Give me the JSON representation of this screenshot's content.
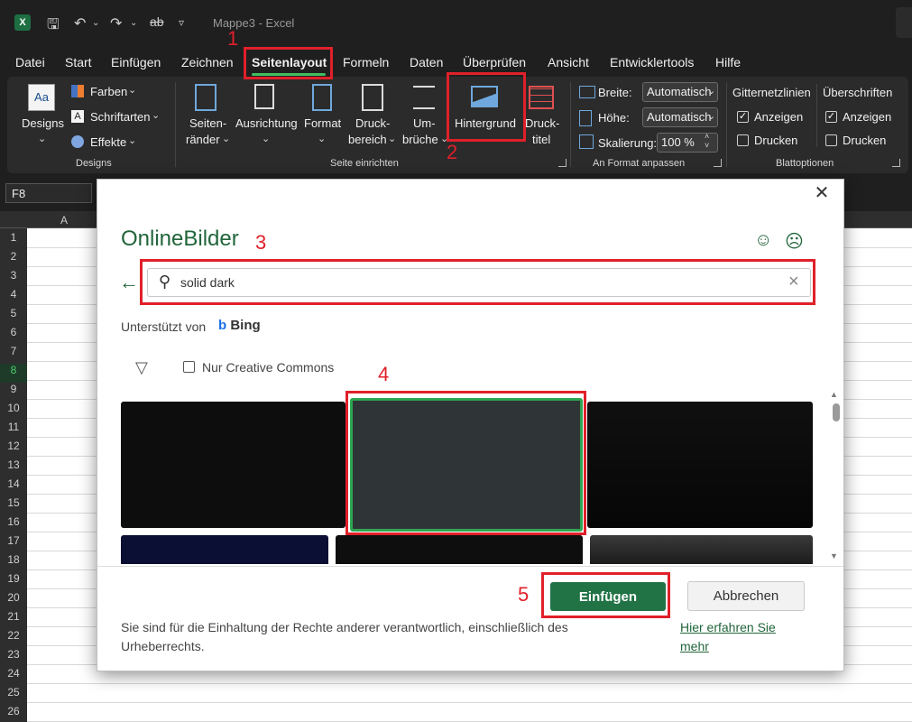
{
  "titlebar": {
    "document_title": "Mappe3  -  Excel"
  },
  "menu": {
    "tabs": [
      "Datei",
      "Start",
      "Einfügen",
      "Zeichnen",
      "Seitenlayout",
      "Formeln",
      "Daten",
      "Überprüfen",
      "Ansicht",
      "Entwicklertools",
      "Hilfe"
    ],
    "active": "Seitenlayout"
  },
  "ribbon": {
    "designs": {
      "designs_label": "Designs",
      "farben": "Farben",
      "schriftarten": "Schriftarten",
      "effekte": "Effekte",
      "group_label": "Designs"
    },
    "seite_einrichten": {
      "seitenraender_1": "Seiten-",
      "seitenraender_2": "ränder",
      "ausrichtung": "Ausrichtung",
      "format": "Format",
      "druckbereich_1": "Druck-",
      "druckbereich_2": "bereich",
      "umbrueche_1": "Um-",
      "umbrueche_2": "brüche",
      "hintergrund": "Hintergrund",
      "drucktitel_1": "Druck-",
      "drucktitel_2": "titel",
      "group_label": "Seite einrichten"
    },
    "an_format_anpassen": {
      "breite_label": "Breite:",
      "breite_value": "Automatisch",
      "hoehe_label": "Höhe:",
      "hoehe_value": "Automatisch",
      "skalierung_label": "Skalierung:",
      "skalierung_value": "100 %",
      "group_label": "An Format anpassen"
    },
    "blattoptionen": {
      "gitternetzlinien": "Gitternetzlinien",
      "ueberschriften": "Überschriften",
      "anzeigen": "Anzeigen",
      "drucken": "Drucken",
      "group_label": "Blattoptionen"
    }
  },
  "namebox": {
    "value": "F8"
  },
  "sheet": {
    "columns": [
      "A"
    ],
    "rows": [
      "1",
      "2",
      "3",
      "4",
      "5",
      "6",
      "7",
      "8",
      "9",
      "10",
      "11",
      "12",
      "13",
      "14",
      "15",
      "16",
      "17",
      "18",
      "19",
      "20",
      "21",
      "22",
      "23",
      "24",
      "25",
      "26"
    ],
    "selected_row": "8"
  },
  "dialog": {
    "title": "OnlineBilder",
    "search_value": "solid dark",
    "powered_by": "Unterstützt von",
    "bing": "Bing",
    "creative_commons_label": "Nur Creative Commons",
    "insert_button": "Einfügen",
    "cancel_button": "Abbrechen",
    "disclaimer": "Sie sind für die Einhaltung der Rechte anderer verantwortlich, einschließlich des Urheberrechts.",
    "learn_more": "Hier erfahren Sie mehr"
  },
  "annotations": {
    "n1": "1",
    "n2": "2",
    "n3": "3",
    "n4": "4",
    "n5": "5",
    "color": "#e0202a"
  },
  "colors": {
    "accent_green": "#217346",
    "dialog_title_green": "#21653a",
    "ribbon_bg": "#2b2b2b"
  }
}
